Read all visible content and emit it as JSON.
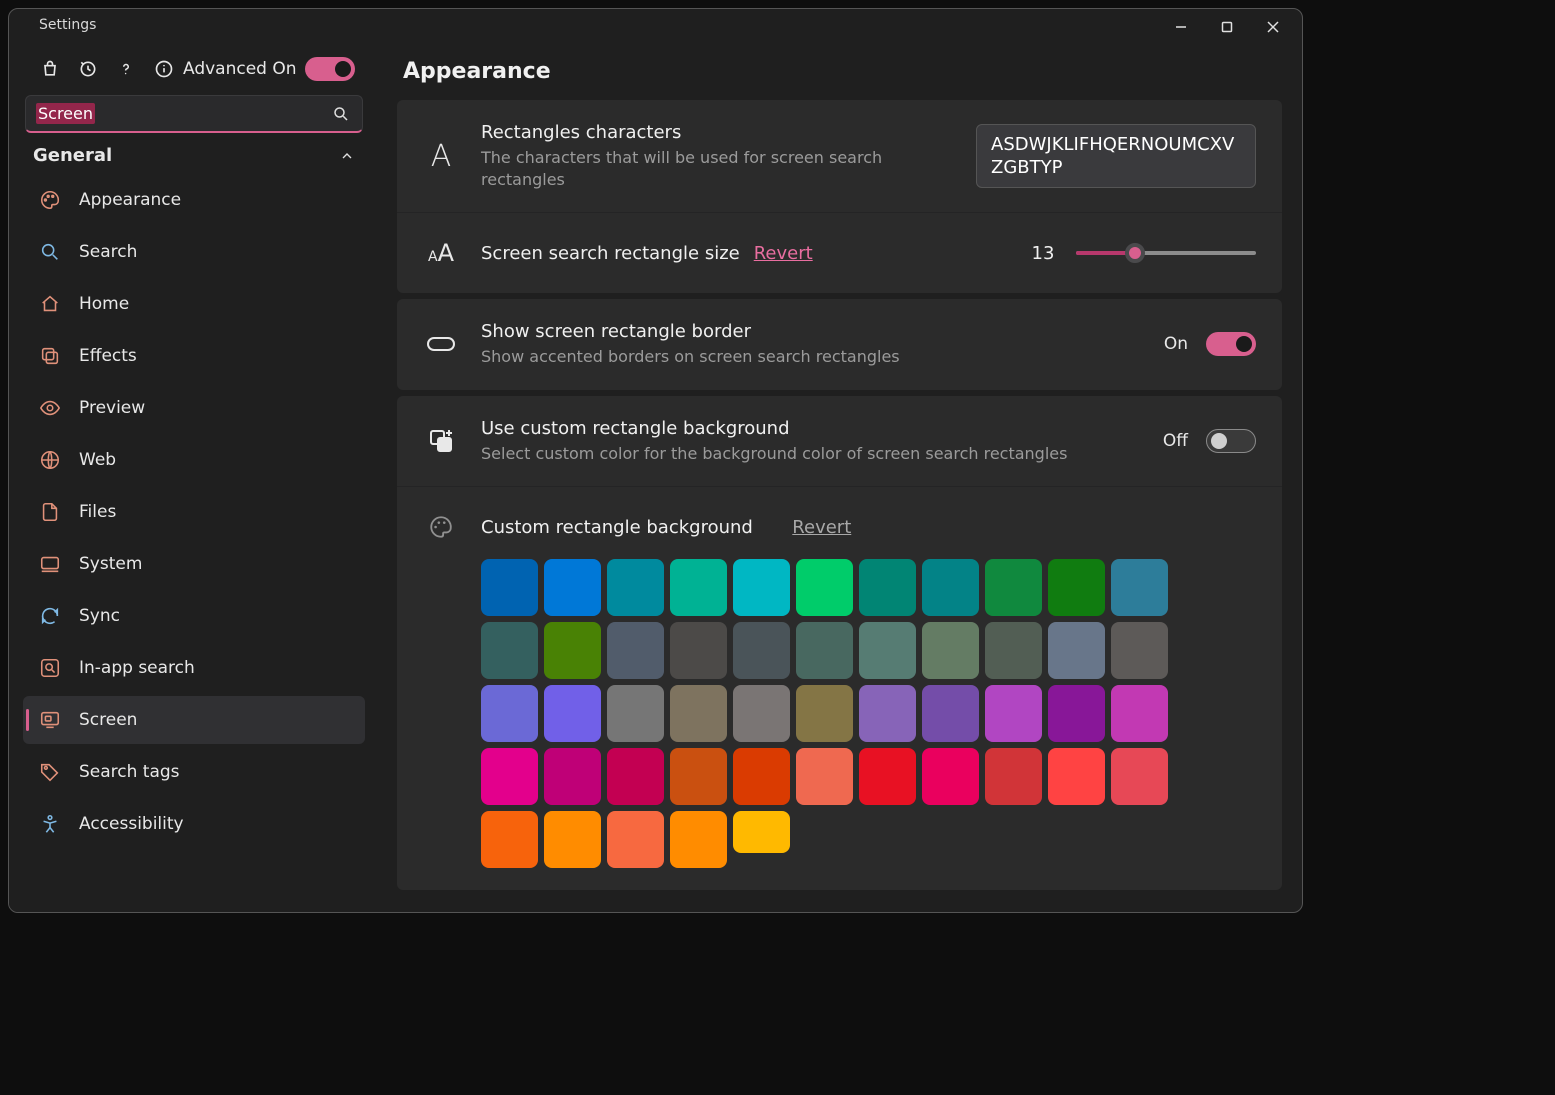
{
  "window": {
    "title": "Settings"
  },
  "toolbar": {
    "advanced_label": "Advanced On",
    "advanced_on": true
  },
  "search": {
    "value": "Screen"
  },
  "section": {
    "label": "General",
    "expanded": true
  },
  "nav": {
    "items": [
      {
        "id": "appearance",
        "label": "Appearance",
        "active": false
      },
      {
        "id": "search",
        "label": "Search",
        "active": false
      },
      {
        "id": "home",
        "label": "Home",
        "active": false
      },
      {
        "id": "effects",
        "label": "Effects",
        "active": false
      },
      {
        "id": "preview",
        "label": "Preview",
        "active": false
      },
      {
        "id": "web",
        "label": "Web",
        "active": false
      },
      {
        "id": "files",
        "label": "Files",
        "active": false
      },
      {
        "id": "system",
        "label": "System",
        "active": false
      },
      {
        "id": "sync",
        "label": "Sync",
        "active": false
      },
      {
        "id": "inapp",
        "label": "In-app search",
        "active": false
      },
      {
        "id": "screen",
        "label": "Screen",
        "active": true
      },
      {
        "id": "searchtags",
        "label": "Search tags",
        "active": false
      },
      {
        "id": "accessibility",
        "label": "Accessibility",
        "active": false
      }
    ]
  },
  "page": {
    "title": "Appearance"
  },
  "rows": {
    "rect_chars": {
      "title": "Rectangles characters",
      "desc": "The characters that will be used for screen search rectangles",
      "value": "ASDWJKLIFHQERNOUMCXVZGBTYP"
    },
    "rect_size": {
      "title": "Screen search rectangle size",
      "revert": "Revert",
      "value": "13",
      "fill_pct": 33
    },
    "show_border": {
      "title": "Show screen rectangle border",
      "desc": "Show accented borders on screen search rectangles",
      "state": "On",
      "on": true
    },
    "custom_bg": {
      "title": "Use custom rectangle background",
      "desc": "Select custom color for the background color of screen search rectangles",
      "state": "Off",
      "on": false
    },
    "bg_color": {
      "title": "Custom rectangle background",
      "revert": "Revert"
    }
  },
  "colors": [
    "#0063b1",
    "#0078d7",
    "#008a9e",
    "#00b294",
    "#00b7c3",
    "#00cc6a",
    "#018574",
    "#038387",
    "#10893e",
    "#107c10",
    "#2d7d9a",
    "#34605f",
    "#498205",
    "#515c6b",
    "#4c4a48",
    "#4a5459",
    "#486860",
    "#567c73",
    "#647c64",
    "#525e54",
    "#68768a",
    "#5d5a58",
    "#6b69d6",
    "#7160e8",
    "#767676",
    "#7e735f",
    "#7a7574",
    "#847545",
    "#8764b8",
    "#744da9",
    "#b146c2",
    "#881798",
    "#c239b3",
    "#e3008c",
    "#bf0077",
    "#c30052",
    "#ca5010",
    "#da3b01",
    "#ef6950",
    "#e81123",
    "#ea005e",
    "#d13438",
    "#ff4343",
    "#e74856",
    "#f7630c",
    "#ff8c00",
    "#f76940",
    "#ff8c00",
    "#ffb900"
  ]
}
